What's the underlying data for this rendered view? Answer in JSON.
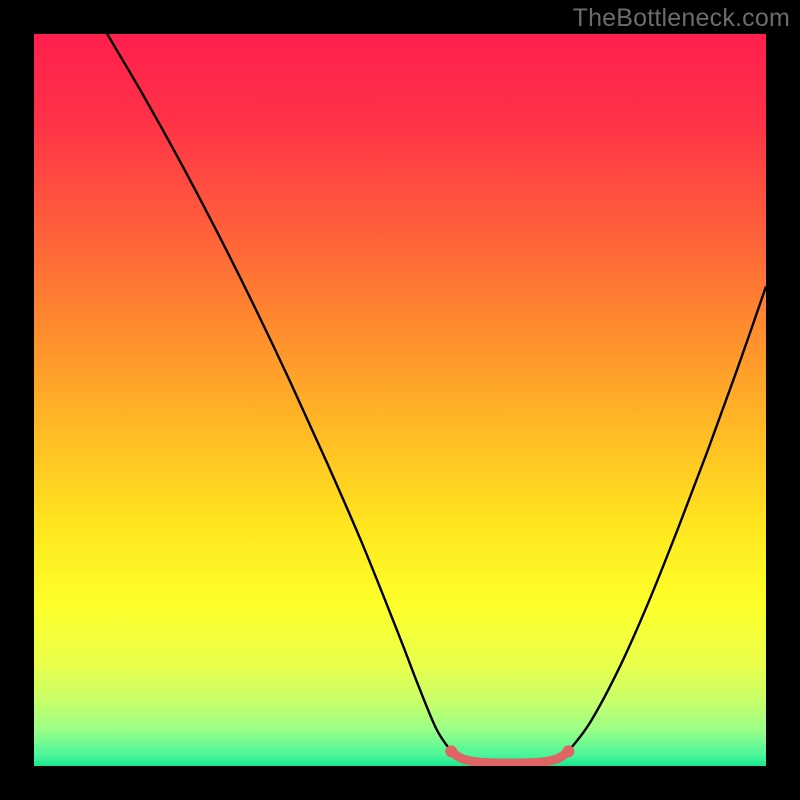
{
  "watermark": "TheBottleneck.com",
  "gradient": {
    "stops": [
      {
        "offset": 0.0,
        "color": "#ff1f4e"
      },
      {
        "offset": 0.12,
        "color": "#ff3247"
      },
      {
        "offset": 0.25,
        "color": "#ff5a3c"
      },
      {
        "offset": 0.4,
        "color": "#ff8b2f"
      },
      {
        "offset": 0.55,
        "color": "#ffbd24"
      },
      {
        "offset": 0.68,
        "color": "#ffe81f"
      },
      {
        "offset": 0.78,
        "color": "#fdff2a"
      },
      {
        "offset": 0.86,
        "color": "#eaff4a"
      },
      {
        "offset": 0.91,
        "color": "#c8ff6a"
      },
      {
        "offset": 0.95,
        "color": "#9bff86"
      },
      {
        "offset": 0.985,
        "color": "#4cf59a"
      },
      {
        "offset": 1.0,
        "color": "#18e78f"
      }
    ]
  },
  "chart_data": {
    "type": "line",
    "title": "",
    "xlabel": "",
    "ylabel": "",
    "xlim": [
      0,
      100
    ],
    "ylim": [
      0,
      100
    ],
    "series": [
      {
        "name": "left-arm",
        "stroke": "#000000",
        "x": [
          10.0,
          15.0,
          20.0,
          25.0,
          30.0,
          35.0,
          40.0,
          45.0,
          50.0,
          52.5,
          55.0,
          57.0
        ],
        "y": [
          100.0,
          91.5,
          82.5,
          73.0,
          63.0,
          52.5,
          41.5,
          30.0,
          17.5,
          11.0,
          5.0,
          2.0
        ]
      },
      {
        "name": "right-arm",
        "stroke": "#000000",
        "x": [
          73.0,
          76.0,
          80.0,
          84.0,
          88.0,
          92.0,
          96.0,
          100.0
        ],
        "y": [
          2.0,
          6.0,
          13.5,
          22.5,
          32.5,
          43.0,
          54.0,
          65.5
        ]
      },
      {
        "name": "bottom-marker",
        "stroke": "#e06464",
        "stroke_width": 9,
        "linecap": "round",
        "x": [
          57.0,
          58.5,
          61.0,
          65.0,
          69.0,
          71.5,
          73.0
        ],
        "y": [
          2.0,
          1.0,
          0.5,
          0.4,
          0.5,
          1.0,
          2.0
        ]
      }
    ],
    "markers": [
      {
        "name": "dot-left",
        "color": "#e06464",
        "x": 57.0,
        "y": 2.0,
        "r": 6
      },
      {
        "name": "dot-right",
        "color": "#e06464",
        "x": 73.0,
        "y": 2.0,
        "r": 6
      }
    ]
  }
}
